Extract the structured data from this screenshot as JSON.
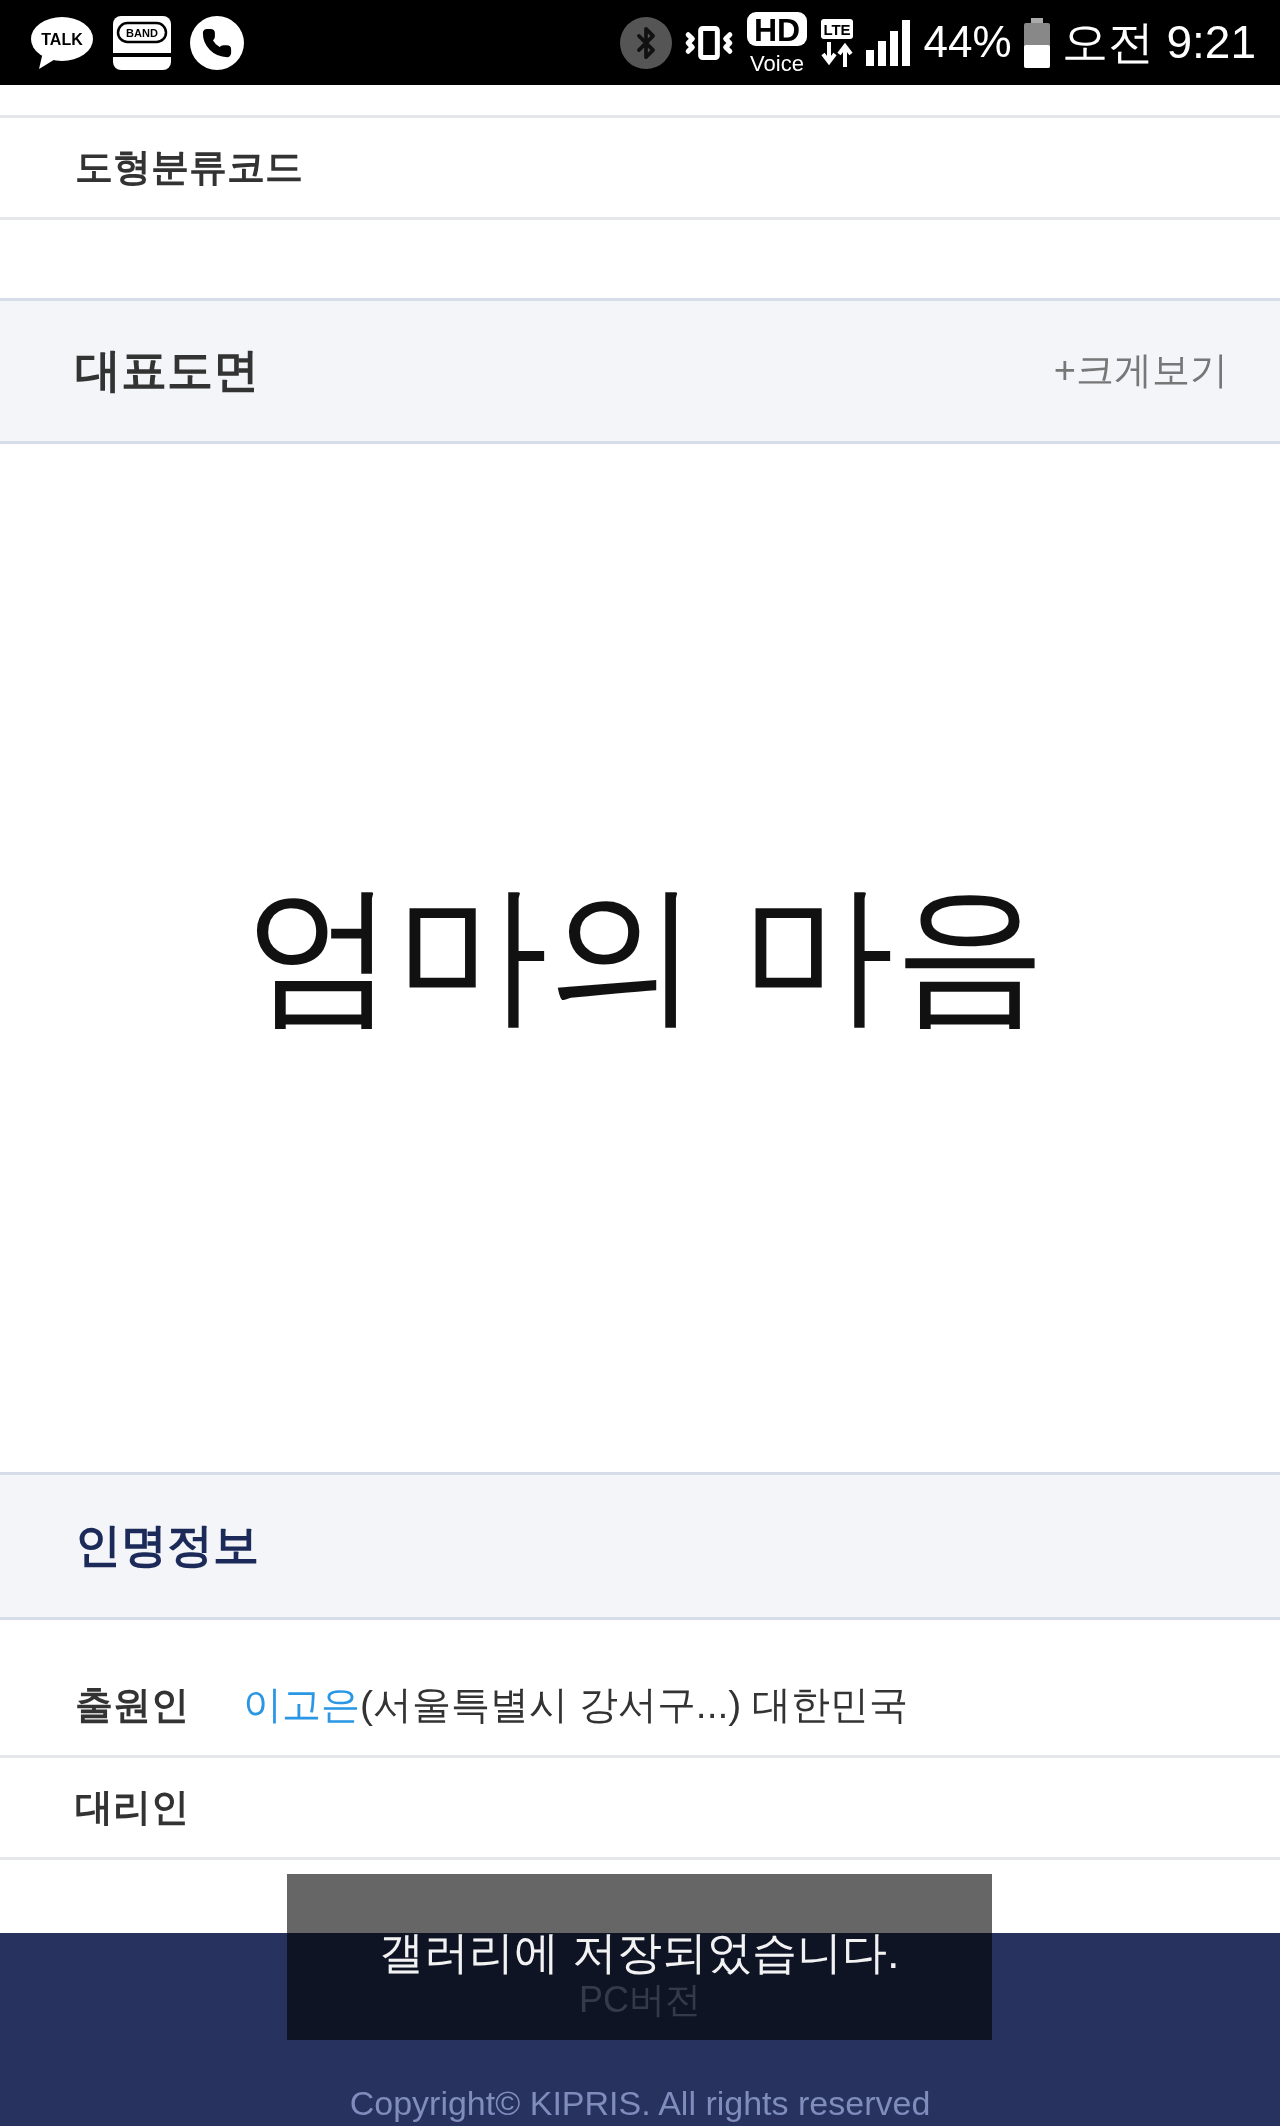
{
  "status_bar": {
    "notifications": [
      {
        "kind": "talk",
        "label": "TALK"
      },
      {
        "kind": "band",
        "label": "BAND"
      },
      {
        "kind": "phone"
      }
    ],
    "hd_voice": {
      "badge": "HD",
      "label": "Voice"
    },
    "network": "LTE",
    "battery_percent": "44%",
    "time": "오전 9:21"
  },
  "classification_row": {
    "label": "도형분류코드"
  },
  "drawing_section": {
    "title": "대표도면",
    "enlarge_link": "+크게보기",
    "drawing_text": "엄마의 마음"
  },
  "people_section": {
    "title": "인명정보",
    "rows": [
      {
        "label": "출원인",
        "name_link": "이고은",
        "details": "(서울특별시 강서구...) 대한민국"
      },
      {
        "label": "대리인"
      }
    ]
  },
  "footer": {
    "pc_version_link": "PC버전",
    "copyright": "Copyright© KIPRIS. All rights reserved"
  },
  "toast": {
    "message": "갤러리에 저장되었습니다."
  }
}
